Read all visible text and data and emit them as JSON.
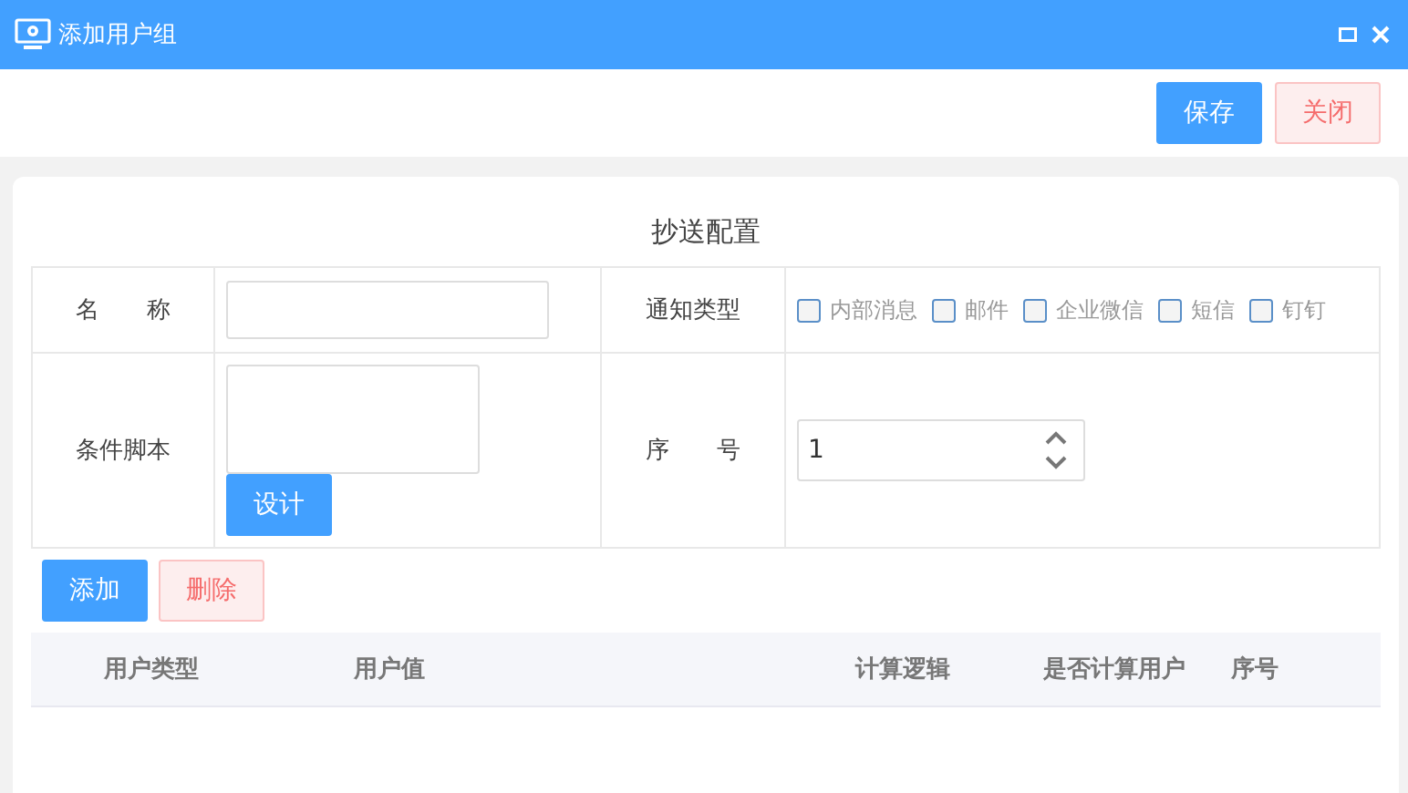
{
  "window": {
    "title": "添加用户组"
  },
  "toolbar": {
    "buttons": [
      {
        "label": "保存",
        "kind": "primary"
      },
      {
        "label": "关闭",
        "kind": "danger"
      }
    ]
  },
  "form": {
    "title": "抄送配置",
    "name": {
      "label": "名　　称"
    },
    "notify": {
      "label": "通知类型",
      "options": [
        {
          "label": "内部消息",
          "checked": false
        },
        {
          "label": "邮件",
          "checked": false
        },
        {
          "label": "企业微信",
          "checked": false
        },
        {
          "label": "短信",
          "checked": false
        },
        {
          "label": "钉钉",
          "checked": false
        }
      ]
    },
    "script": {
      "label": "条件脚本",
      "button": "设计"
    },
    "order": {
      "label": "序　　号",
      "value": "1"
    }
  },
  "actions": [
    {
      "label": "添加",
      "kind": "primary"
    },
    {
      "label": "删除",
      "kind": "danger"
    }
  ],
  "table": {
    "columns": [
      "用户类型",
      "用户值",
      "计算逻辑",
      "是否计算用户",
      "序号"
    ]
  }
}
